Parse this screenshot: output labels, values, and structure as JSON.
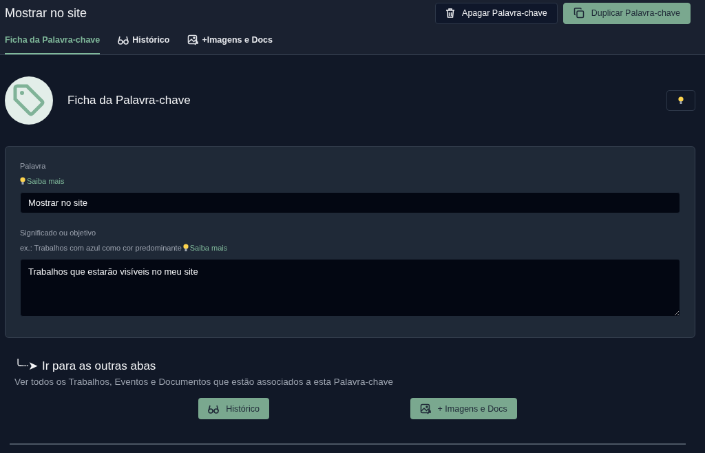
{
  "header": {
    "title": "Mostrar no site",
    "buttons": [
      {
        "label": "Apagar Palavra-chave",
        "kind": "delete"
      },
      {
        "label": "Duplicar Palavra-chave",
        "kind": "duplicate"
      }
    ]
  },
  "tabs": [
    {
      "label": "Ficha da Palavra-chave",
      "kind": "form",
      "selected": true
    },
    {
      "label": "Histórico",
      "kind": "history",
      "selected": false
    },
    {
      "label": "+Imagens e Docs",
      "kind": "media",
      "selected": false
    }
  ],
  "section": {
    "title": "Ficha da Palavra-chave"
  },
  "fields": [
    {
      "label": "Palavra",
      "help_link": "Saiba mais",
      "value": "Mostrar no site",
      "kind": "input"
    },
    {
      "label": "Significado ou objetivo",
      "hint": "ex.: Trabalhos com azul como cor predominante",
      "help_link": "Saiba mais",
      "value": "Trabalhos que estarão visíveis no meu site",
      "kind": "textarea"
    }
  ],
  "other_tabs": {
    "arrow": "╰┈➤",
    "title": "Ir para as outras abas",
    "description": "Ver todos os Trabalhos, Eventos e Documentos que estão associados a esta Palavra-chave",
    "buttons": [
      {
        "label": "Histórico",
        "kind": "history"
      },
      {
        "label": "+ Imagens e Docs",
        "kind": "media"
      }
    ]
  }
}
